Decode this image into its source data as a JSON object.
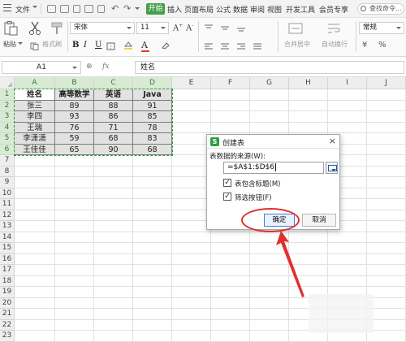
{
  "menubar": {
    "file_label": "文件",
    "start_tab": "开始",
    "tabs": [
      "插入",
      "页面布局",
      "公式",
      "数据",
      "审阅",
      "视图",
      "开发工具",
      "会员专享"
    ],
    "search_placeholder": "查找命令..."
  },
  "toolbar": {
    "paste_label": "粘贴",
    "cut_label": "剪切",
    "format_painter_label": "格式刷",
    "font_name": "宋体",
    "font_size": "11",
    "merge_label": "合并居中",
    "wrap_label": "自动换行",
    "number_format": "常规",
    "bold": "B",
    "italic": "I",
    "underline": "U"
  },
  "formula_bar": {
    "cell_ref": "A1",
    "fx": "fx",
    "content": "姓名"
  },
  "grid": {
    "columns": [
      "A",
      "B",
      "C",
      "D",
      "E",
      "F",
      "G",
      "H",
      "I",
      "J"
    ],
    "rows": [
      "1",
      "2",
      "3",
      "4",
      "5",
      "6",
      "7",
      "8",
      "9",
      "10",
      "11",
      "12",
      "13",
      "14",
      "15",
      "16",
      "17",
      "18",
      "19",
      "20",
      "21",
      "22",
      "23"
    ],
    "table": [
      [
        "姓名",
        "高等数学",
        "英语",
        "Java"
      ],
      [
        "张三",
        "89",
        "88",
        "91"
      ],
      [
        "李四",
        "93",
        "86",
        "85"
      ],
      [
        "王瑞",
        "76",
        "71",
        "78"
      ],
      [
        "李潇潇",
        "59",
        "68",
        "83"
      ],
      [
        "王佳佳",
        "65",
        "90",
        "68"
      ]
    ]
  },
  "dialog": {
    "title": "创建表",
    "logo": "S",
    "close": "×",
    "source_label": "表数据的来源(W):",
    "range_value": "=$A$1:$D$6",
    "checkbox_headers": "表包含标题(M)",
    "checkbox_filter": "筛选按钮(F)",
    "checkbox_headers_checked": true,
    "checkbox_filter_checked": true,
    "ok_label": "确定",
    "cancel_label": "取消"
  },
  "colors": {
    "accent_green": "#43a047",
    "selection_green": "#2e9e3e",
    "annotation_red": "#e0312f",
    "ok_border": "#3f7fd6"
  }
}
